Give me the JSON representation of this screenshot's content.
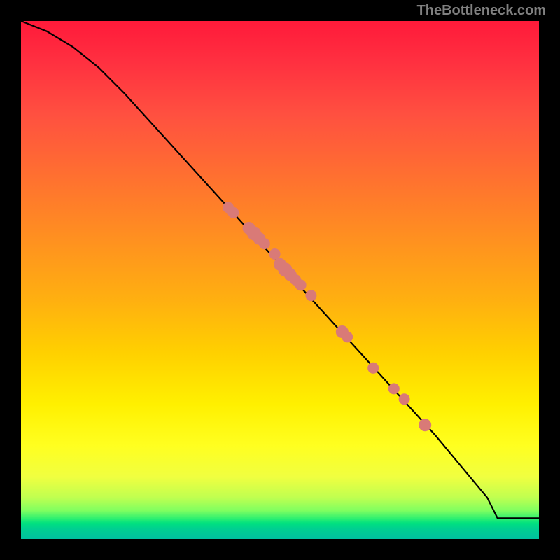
{
  "watermark": "TheBottleneck.com",
  "chart_data": {
    "type": "line",
    "title": "",
    "xlabel": "",
    "ylabel": "",
    "xlim": [
      0,
      100
    ],
    "ylim": [
      0,
      100
    ],
    "series": [
      {
        "name": "curve",
        "x": [
          0,
          5,
          10,
          15,
          20,
          30,
          40,
          50,
          60,
          70,
          80,
          85,
          90,
          92,
          100
        ],
        "y": [
          100,
          98,
          95,
          91,
          86,
          75,
          64,
          53,
          42,
          31,
          20,
          14,
          8,
          4,
          4
        ]
      }
    ],
    "markers": {
      "name": "points",
      "x": [
        40,
        41,
        44,
        45,
        46,
        47,
        49,
        50,
        51,
        52,
        53,
        54,
        56,
        62,
        63,
        68,
        72,
        74,
        78
      ],
      "y": [
        64,
        63,
        60,
        59,
        58,
        57,
        55,
        53,
        52,
        51,
        50,
        49,
        47,
        40,
        39,
        33,
        29,
        27,
        22
      ],
      "r": [
        8,
        8,
        9,
        10,
        9,
        8,
        8,
        9,
        10,
        9,
        8,
        8,
        8,
        9,
        8,
        8,
        8,
        8,
        9
      ]
    }
  }
}
